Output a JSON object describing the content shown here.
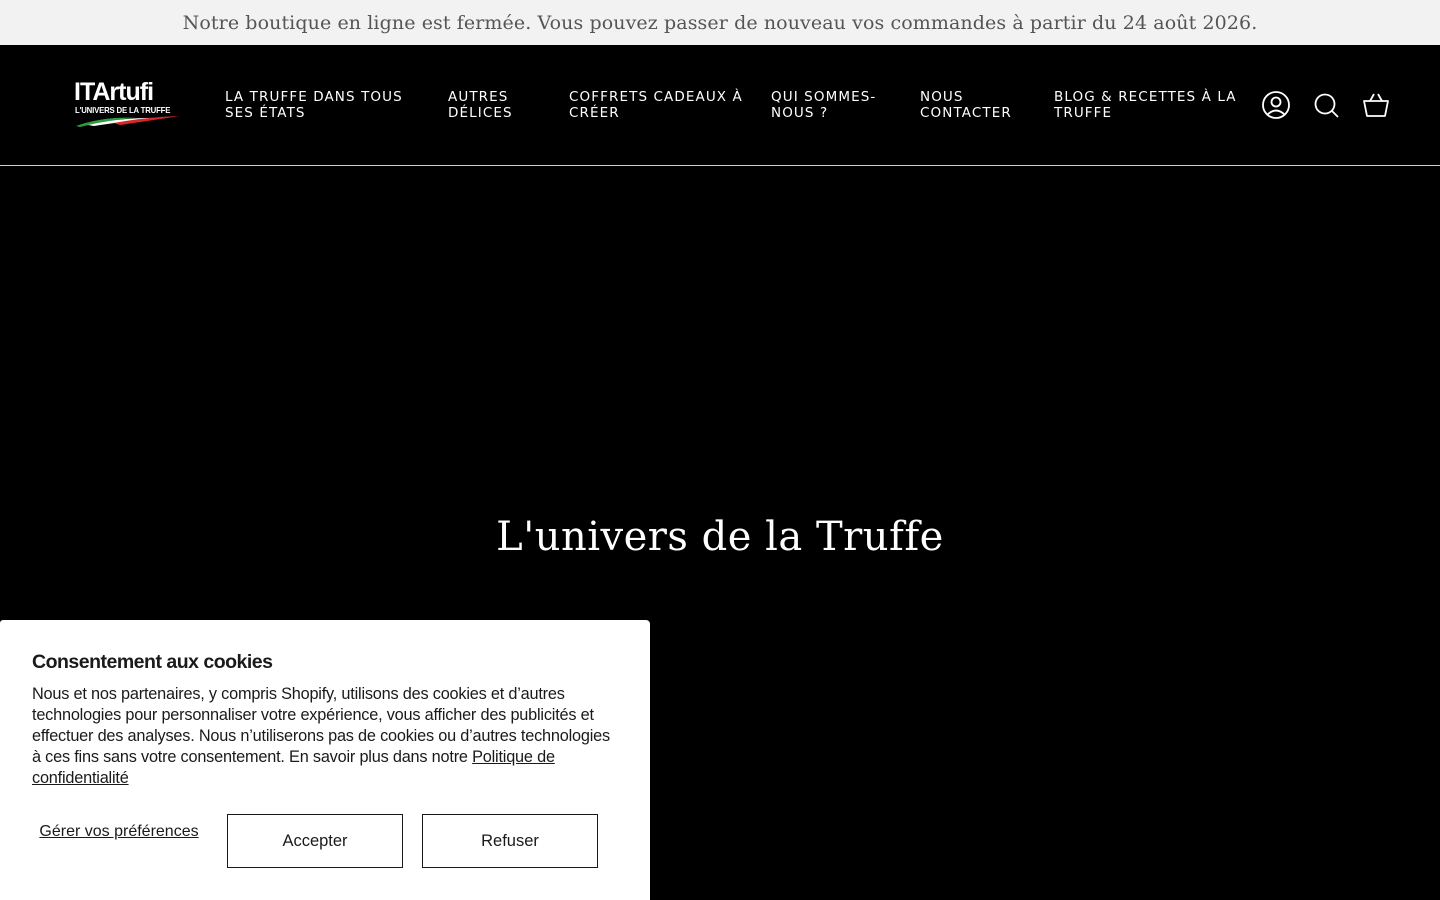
{
  "announcement": {
    "text": "Notre boutique en ligne est fermée. Vous pouvez passer de nouveau vos commandes à partir du 24 août 2026."
  },
  "header": {
    "logo": {
      "brand": "ITArtufi",
      "tagline": "L'UNIVERS DE LA TRUFFE",
      "flag_colors": [
        "#2e9b3f",
        "#ffffff",
        "#d62828"
      ]
    },
    "nav": [
      {
        "label": "LA TRUFFE DANS TOUS SES ÉTATS"
      },
      {
        "label": "AUTRES DÉLICES"
      },
      {
        "label": "COFFRETS CADEAUX À CRÉER"
      },
      {
        "label": "QUI SOMMES-NOUS ?"
      },
      {
        "label": "NOUS CONTACTER"
      },
      {
        "label": "BLOG & RECETTES À LA TRUFFE"
      }
    ],
    "icons": {
      "account": "account-icon",
      "search": "search-icon",
      "cart": "cart-icon"
    }
  },
  "hero": {
    "title": "L'univers de la Truffe"
  },
  "cookie_banner": {
    "title": "Consentement aux cookies",
    "body": "Nous et nos partenaires, y compris Shopify, utilisons des cookies et d’autres technologies pour personnaliser votre expérience, vous afficher des publicités et effectuer des analyses. Nous n’utiliserons pas de cookies ou d’autres technologies à ces fins sans votre consentement. En savoir plus dans notre ",
    "link": "Politique de confidentialité",
    "manage_label": "Gérer vos préférences",
    "accept_label": "Accepter",
    "decline_label": "Refuser"
  }
}
